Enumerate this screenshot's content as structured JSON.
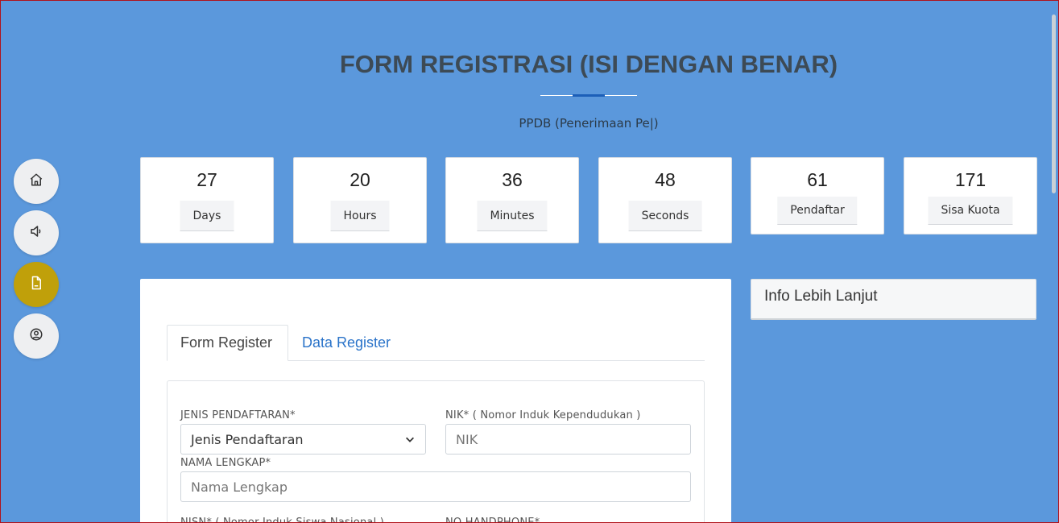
{
  "header": {
    "title": "FORM REGISTRASI (ISI DENGAN BENAR)",
    "subtitle": "PPDB (Penerimaan Pe|)"
  },
  "sidebar": {
    "items": [
      {
        "icon": "home-icon",
        "active": false
      },
      {
        "icon": "speaker-icon",
        "active": false
      },
      {
        "icon": "document-icon",
        "active": true
      },
      {
        "icon": "user-circle-icon",
        "active": false
      }
    ]
  },
  "counters": [
    {
      "value": "27",
      "label": "Days"
    },
    {
      "value": "20",
      "label": "Hours"
    },
    {
      "value": "36",
      "label": "Minutes"
    },
    {
      "value": "48",
      "label": "Seconds"
    },
    {
      "value": "61",
      "label": "Pendaftar"
    },
    {
      "value": "171",
      "label": "Sisa Kuota"
    }
  ],
  "tabs": {
    "form_register": "Form Register",
    "data_register": "Data Register"
  },
  "form": {
    "jenis_label": "JENIS PENDAFTARAN*",
    "jenis_value": "Jenis Pendaftaran",
    "nik_label": "NIK* ( Nomor Induk Kependudukan )",
    "nik_placeholder": "NIK",
    "nama_label": "NAMA LENGKAP*",
    "nama_placeholder": "Nama Lengkap",
    "nisn_label": "NISN* ( Nomor Induk Siswa Nasional )",
    "hp_label": "NO HANDPHONE*"
  },
  "info": {
    "title": "Info Lebih Lanjut"
  },
  "colors": {
    "background": "#5b98dc",
    "active_nav": "#c0a00a",
    "link": "#2a73c9",
    "accent_line": "#1c5fb8"
  }
}
